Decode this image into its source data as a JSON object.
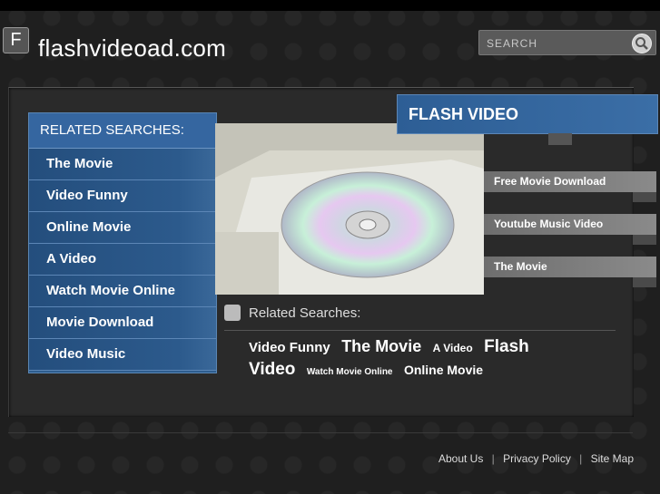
{
  "header": {
    "logo_letter": "F",
    "site_title": "flashvideoad.com",
    "search_placeholder": "SEARCH"
  },
  "left_menu": {
    "title": "RELATED SEARCHES:",
    "items": [
      "The Movie",
      "Video Funny",
      "Online Movie",
      "A Video",
      "Watch Movie Online",
      "Movie Download",
      "Video Music"
    ]
  },
  "right_panel": {
    "title": "FLASH VIDEO",
    "items": [
      "Free Movie Download",
      "Youtube Music Video",
      "The Movie"
    ]
  },
  "related": {
    "title": "Related Searches:",
    "tags": [
      "Video Funny",
      "The Movie",
      "A Video",
      "Flash Video",
      "Watch Movie Online",
      "Online Movie"
    ]
  },
  "footer": {
    "links": [
      "About Us",
      "Privacy Policy",
      "Site Map"
    ],
    "separator": "|"
  }
}
